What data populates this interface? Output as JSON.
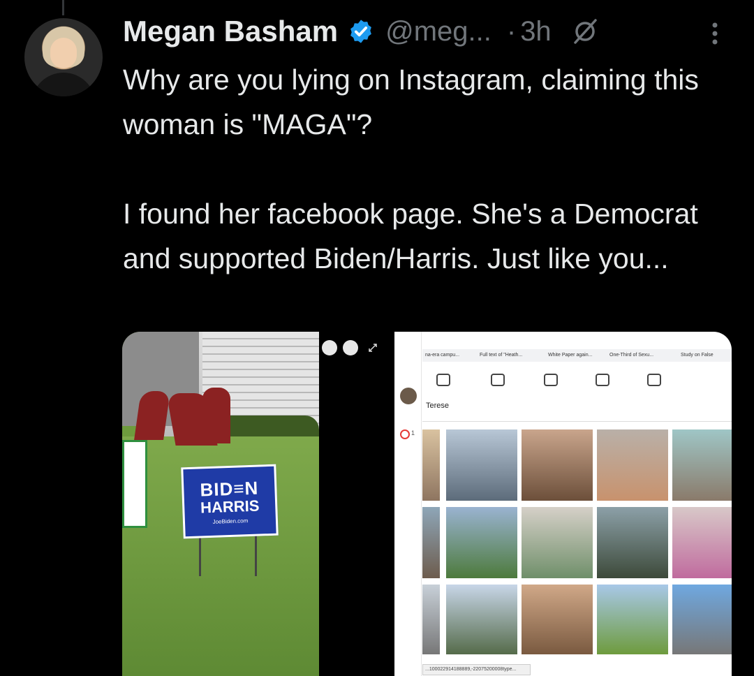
{
  "tweet": {
    "author_name": "Megan Basham",
    "handle": "@meg...",
    "separator": "·",
    "time": "3h",
    "paragraphs": [
      "Why are you lying on Instagram, claiming this woman is \"MAGA\"?",
      "I found her facebook page. She's a Democrat and supported Biden/Harris. Just like you..."
    ]
  },
  "media": {
    "yard_sign": {
      "line1": "BID≡N",
      "line2": "HARRIS",
      "line3": "JoeBiden.com"
    },
    "browser_tabs": [
      "na-era campu...",
      "Full text of \"Heath...",
      "White Paper again...",
      "One-Third of Sexu...",
      "Study on False"
    ],
    "profile_name": "Terese",
    "status_url": "...100022914188889,-22075200008type...",
    "reaction_count": "1"
  },
  "colors": {
    "background": "#000000",
    "text": "#e7e9ea",
    "muted": "#71767b",
    "verified": "#1d9bf0"
  }
}
